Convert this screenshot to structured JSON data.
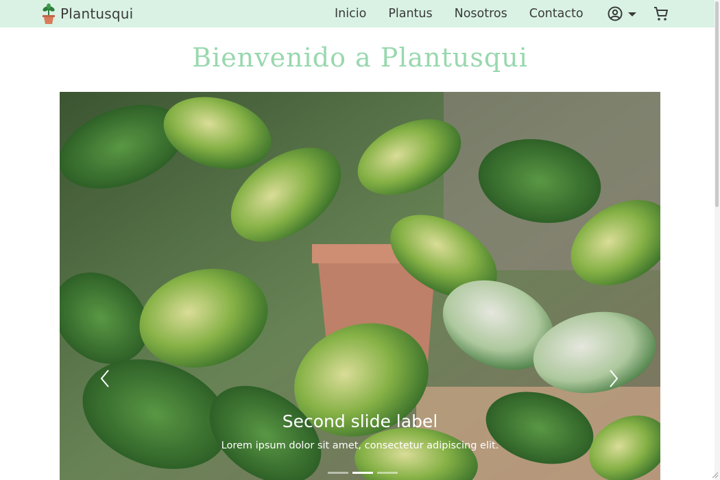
{
  "brand": {
    "name": "Plantusqui"
  },
  "nav": {
    "links": [
      "Inicio",
      "Plantus",
      "Nosotros",
      "Contacto"
    ]
  },
  "page": {
    "title": "Bienvenido a Plantusqui"
  },
  "carousel": {
    "active_index": 1,
    "slide_count": 3,
    "caption_title": "Second slide label",
    "caption_text": "Lorem ipsum dolor sit amet, consectetur adipiscing elit."
  },
  "colors": {
    "navbar_bg": "#d9f2e4",
    "title_green": "#98d8ae",
    "text_dark": "#3a3a3a"
  },
  "icons": [
    "potted-plant-logo-icon",
    "account-circle-icon",
    "caret-down-icon",
    "shopping-cart-icon",
    "chevron-left-icon",
    "chevron-right-icon"
  ]
}
